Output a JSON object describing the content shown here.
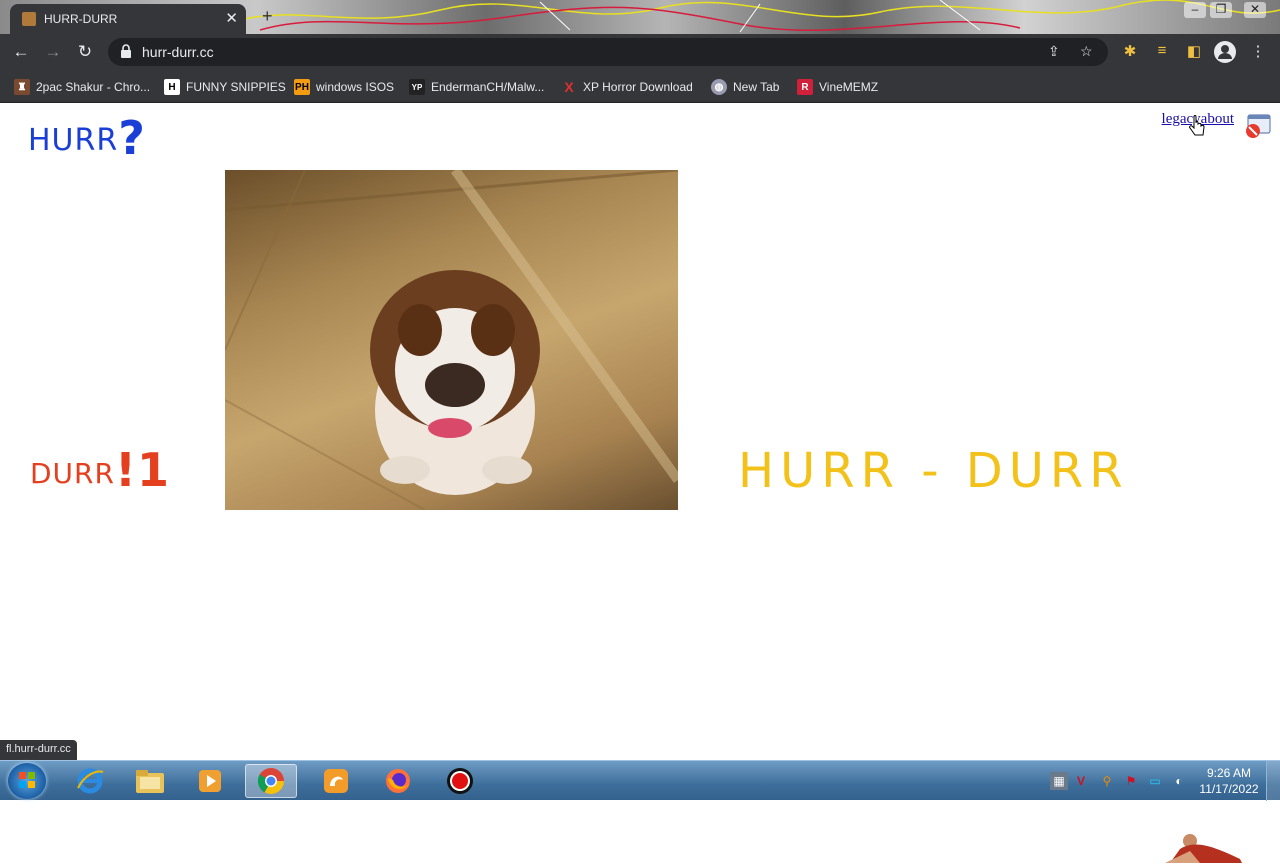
{
  "browser": {
    "tab_title": "HURR-DURR",
    "url": "hurr-durr.cc",
    "status_url": "fl.hurr-durr.cc",
    "bookmarks": [
      {
        "label": "2pac Shakur - Chro...",
        "icon": "2pac-favicon",
        "color": "#c0392b"
      },
      {
        "label": "FUNNY SNIPPIES",
        "icon": "h-favicon",
        "color": "#222222"
      },
      {
        "label": "windows ISOS",
        "icon": "ph-favicon",
        "color": "#f39c12"
      },
      {
        "label": "EndermanCH/Malw...",
        "icon": "yp-favicon",
        "color": "#333333"
      },
      {
        "label": "XP Horror Download",
        "icon": "x-favicon",
        "color": "#e03030"
      },
      {
        "label": "New Tab",
        "icon": "globe-favicon",
        "color": "#8a8aa0"
      },
      {
        "label": "VineMEMZ",
        "icon": "r-favicon",
        "color": "#d0203a"
      }
    ]
  },
  "page": {
    "hurr_text": "HURR",
    "hurr_mark": "?",
    "links": {
      "legacy": "legacy",
      "about": "about"
    },
    "durr_text": "DURR",
    "durr_mark": "!1",
    "big_title": "HURR - DURR",
    "image_alt": "bulldog"
  },
  "taskbar": {
    "time": "9:26 AM",
    "date": "11/17/2022",
    "apps": [
      "internet-explorer-icon",
      "file-explorer-icon",
      "media-player-icon",
      "chrome-icon",
      "uc-browser-icon",
      "firefox-icon",
      "record-icon"
    ]
  }
}
